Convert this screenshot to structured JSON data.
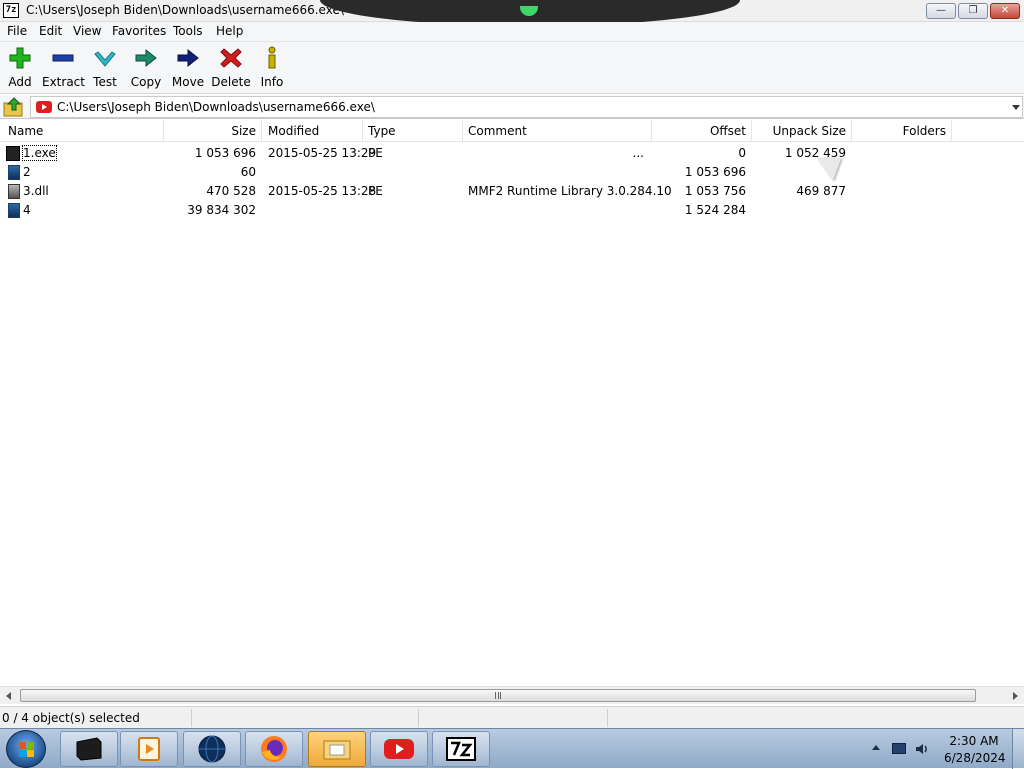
{
  "window": {
    "app_icon": "7z",
    "title": "C:\\Users\\Joseph Biden\\Downloads\\username666.exe\\"
  },
  "menu": [
    "File",
    "Edit",
    "View",
    "Favorites",
    "Tools",
    "Help"
  ],
  "toolbar": [
    {
      "label": "Add",
      "icon": "add-icon"
    },
    {
      "label": "Extract",
      "icon": "extract-icon"
    },
    {
      "label": "Test",
      "icon": "test-icon"
    },
    {
      "label": "Copy",
      "icon": "copy-icon"
    },
    {
      "label": "Move",
      "icon": "move-icon"
    },
    {
      "label": "Delete",
      "icon": "delete-icon"
    },
    {
      "label": "Info",
      "icon": "info-icon"
    }
  ],
  "address": {
    "path": "C:\\Users\\Joseph Biden\\Downloads\\username666.exe\\"
  },
  "columns": [
    "Name",
    "Size",
    "Modified",
    "Type",
    "Comment",
    "Offset",
    "Unpack Size",
    "Folders"
  ],
  "files": [
    {
      "name": "1.exe",
      "size": "1 053 696",
      "modified": "2015-05-25 13:29",
      "type": "PE",
      "comment": "...",
      "offset": "0",
      "unpack_size": "1 052 459",
      "icon": "exe-file-icon"
    },
    {
      "name": "2",
      "size": "60",
      "modified": "",
      "type": "",
      "comment": "",
      "offset": "1 053 696",
      "unpack_size": "",
      "icon": "file-icon"
    },
    {
      "name": "3.dll",
      "size": "470 528",
      "modified": "2015-05-25 13:28",
      "type": "PE",
      "comment": "MMF2 Runtime Library 3.0.284.10",
      "offset": "1 053 756",
      "unpack_size": "469 877",
      "icon": "dll-file-icon"
    },
    {
      "name": "4",
      "size": "39 834 302",
      "modified": "",
      "type": "",
      "comment": "",
      "offset": "1 524 284",
      "unpack_size": "",
      "icon": "file-icon"
    }
  ],
  "status": {
    "selection": "0 / 4 object(s) selected"
  },
  "taskbar": {
    "apps": [
      {
        "name": "windows-explorer-app",
        "active": false
      },
      {
        "name": "media-player-app",
        "active": false
      },
      {
        "name": "globe-app",
        "active": false
      },
      {
        "name": "firefox-app",
        "active": false
      },
      {
        "name": "file-explorer-app",
        "active": true
      },
      {
        "name": "youtube-app",
        "active": false
      },
      {
        "name": "7zip-app",
        "active": false
      }
    ],
    "clock_time": "2:30 AM",
    "clock_date": "6/28/2024"
  },
  "colors": {
    "add": "#1fb51f",
    "extract": "#1f3fa8",
    "test": "#2fb8c8",
    "copy": "#1a8a6a",
    "move": "#12207a",
    "delete": "#d41c1c",
    "info": "#c8b400",
    "youtube_red": "#e01e1e"
  }
}
